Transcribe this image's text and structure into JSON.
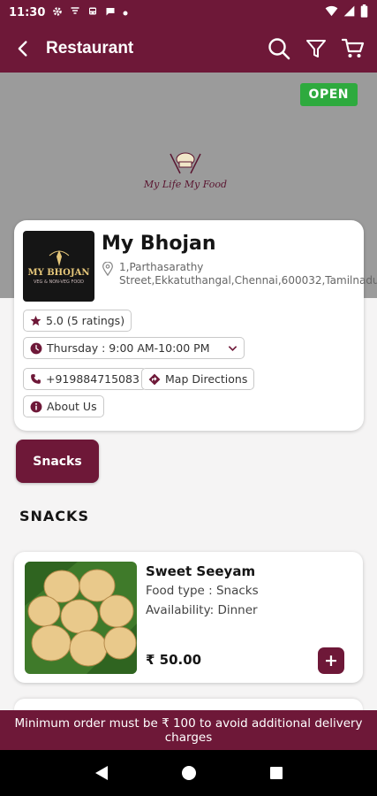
{
  "status_bar": {
    "time": "11:30"
  },
  "app_bar": {
    "title": "Restaurant"
  },
  "banner": {
    "status_badge": "OPEN",
    "logo_text": "My Life My Food"
  },
  "restaurant": {
    "logo_line1": "MY BHOJAN",
    "logo_line2": "VEG & NON-VEG FOOD",
    "name": "My Bhojan",
    "address": "1,Parthasarathy Street,Ekkatuthangal,Chennai,600032,Tamilnadu",
    "rating": "5.0 (5 ratings)",
    "hours": "Thursday : 9:00 AM-10:00 PM",
    "phone": "+919884715083",
    "map_label": "Map Directions",
    "about_label": "About Us"
  },
  "category_button": "Snacks",
  "section_title": "SNACKS",
  "items": [
    {
      "name": "Sweet Seeyam",
      "food_type": "Food type : Snacks",
      "availability": "Availability: Dinner",
      "price": "₹ 50.00",
      "add_label": "+"
    }
  ],
  "min_order_note": "Minimum order must be ₹ 100 to avoid additional delivery charges",
  "colors": {
    "primary": "#6e1838",
    "open": "#2eaa3e",
    "banner": "#9b9b9b"
  }
}
